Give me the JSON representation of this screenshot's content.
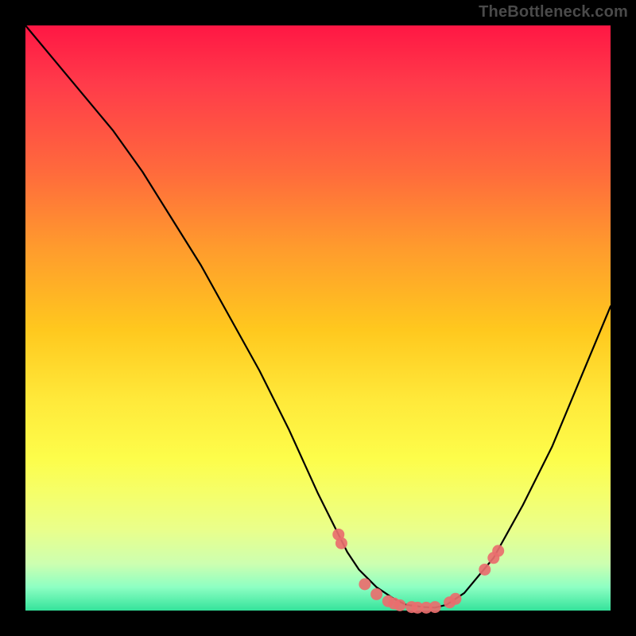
{
  "watermark": "TheBottleneck.com",
  "colors": {
    "background": "#000000",
    "gradient_top": "#ff1744",
    "gradient_bottom": "#34e39b",
    "curve": "#000000",
    "dot": "#e96e6e"
  },
  "chart_data": {
    "type": "line",
    "title": "",
    "xlabel": "",
    "ylabel": "",
    "xlim": [
      0,
      100
    ],
    "ylim": [
      0,
      100
    ],
    "series": [
      {
        "name": "curve",
        "x": [
          0,
          5,
          10,
          15,
          20,
          25,
          30,
          35,
          40,
          45,
          50,
          53,
          55,
          57,
          60,
          63,
          65,
          68,
          70,
          72,
          75,
          80,
          85,
          90,
          95,
          100
        ],
        "y": [
          100,
          94,
          88,
          82,
          75,
          67,
          59,
          50,
          41,
          31,
          20,
          14,
          10,
          7,
          4,
          2,
          1,
          0.6,
          0.5,
          1,
          3,
          9,
          18,
          28,
          40,
          52
        ]
      }
    ],
    "dots": [
      {
        "x": 53.5,
        "y": 13.0
      },
      {
        "x": 54.0,
        "y": 11.5
      },
      {
        "x": 58.0,
        "y": 4.5
      },
      {
        "x": 60.0,
        "y": 2.8
      },
      {
        "x": 62.0,
        "y": 1.6
      },
      {
        "x": 63.0,
        "y": 1.2
      },
      {
        "x": 64.0,
        "y": 0.9
      },
      {
        "x": 66.0,
        "y": 0.6
      },
      {
        "x": 67.0,
        "y": 0.5
      },
      {
        "x": 68.5,
        "y": 0.5
      },
      {
        "x": 70.0,
        "y": 0.6
      },
      {
        "x": 72.5,
        "y": 1.4
      },
      {
        "x": 73.5,
        "y": 2.0
      },
      {
        "x": 78.5,
        "y": 7.0
      },
      {
        "x": 80.0,
        "y": 9.0
      },
      {
        "x": 80.8,
        "y": 10.2
      }
    ]
  }
}
